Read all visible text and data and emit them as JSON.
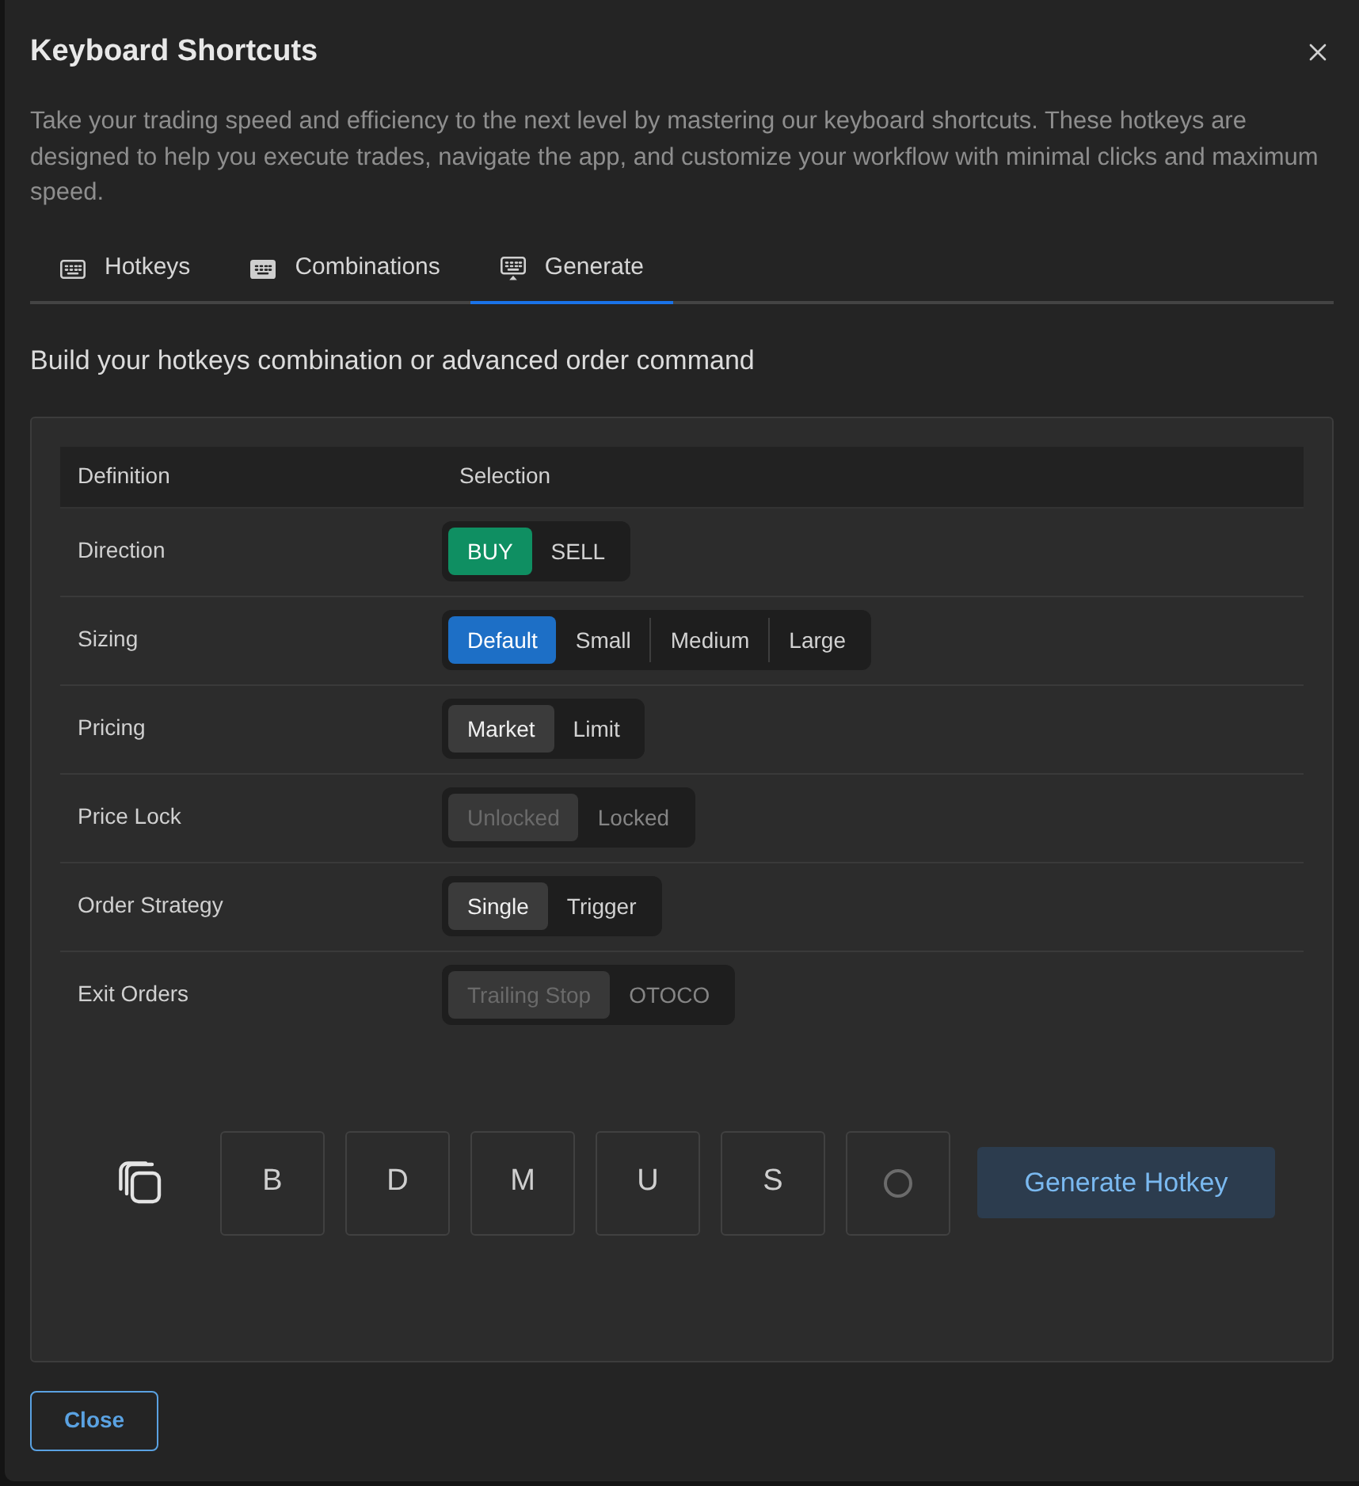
{
  "dialog": {
    "title": "Keyboard Shortcuts",
    "description": "Take your trading speed and efficiency to the next level by mastering our keyboard shortcuts. These hotkeys are designed to help you execute trades, navigate the app, and customize your workflow with minimal clicks and maximum speed."
  },
  "tabs": [
    {
      "label": "Hotkeys",
      "selected": false
    },
    {
      "label": "Combinations",
      "selected": false
    },
    {
      "label": "Generate",
      "selected": true
    }
  ],
  "section_title": "Build your hotkeys combination or advanced order command",
  "table": {
    "columns": [
      "Definition",
      "Selection"
    ],
    "rows": [
      {
        "definition": "Direction",
        "kind": "buy",
        "disabled": false,
        "options": [
          {
            "label": "BUY",
            "selected": true
          },
          {
            "label": "SELL",
            "selected": false
          }
        ]
      },
      {
        "definition": "Sizing",
        "kind": "primary",
        "disabled": false,
        "options": [
          {
            "label": "Default",
            "selected": true
          },
          {
            "label": "Small",
            "selected": false
          },
          {
            "label": "Medium",
            "selected": false
          },
          {
            "label": "Large",
            "selected": false
          }
        ]
      },
      {
        "definition": "Pricing",
        "kind": "neutral",
        "disabled": false,
        "options": [
          {
            "label": "Market",
            "selected": true
          },
          {
            "label": "Limit",
            "selected": false
          }
        ]
      },
      {
        "definition": "Price Lock",
        "kind": "neutral",
        "disabled": true,
        "options": [
          {
            "label": "Unlocked",
            "selected": true
          },
          {
            "label": "Locked",
            "selected": false
          }
        ]
      },
      {
        "definition": "Order Strategy",
        "kind": "neutral",
        "disabled": false,
        "options": [
          {
            "label": "Single",
            "selected": true
          },
          {
            "label": "Trigger",
            "selected": false
          }
        ]
      },
      {
        "definition": "Exit Orders",
        "kind": "neutral",
        "disabled": true,
        "options": [
          {
            "label": "Trailing Stop",
            "selected": true
          },
          {
            "label": "OTOCO",
            "selected": false
          }
        ]
      }
    ]
  },
  "keys": [
    {
      "kind": "letter",
      "label": "B"
    },
    {
      "kind": "letter",
      "label": "D"
    },
    {
      "kind": "letter",
      "label": "M"
    },
    {
      "kind": "letter",
      "label": "U"
    },
    {
      "kind": "letter",
      "label": "S"
    },
    {
      "kind": "empty"
    }
  ],
  "generate_button": "Generate Hotkey",
  "footer_buttons": [
    "Close"
  ]
}
